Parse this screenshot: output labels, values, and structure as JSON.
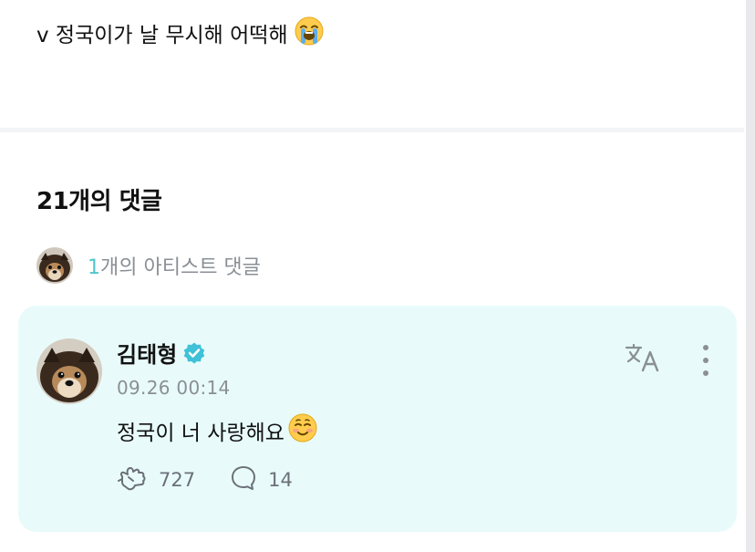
{
  "post": {
    "text": "v 정국이가 날 무시해 어떡해",
    "emoji": "loudly-crying-face"
  },
  "comments_header": {
    "title": "21개의 댓글"
  },
  "artist_comments": {
    "count": "1",
    "label": "개의 아티스트 댓글"
  },
  "comment": {
    "author": "김태형",
    "verified": true,
    "timestamp": "09.26 00:14",
    "text": "정국이 너 사랑해요",
    "emoji": "smiling-face",
    "likes": "727",
    "replies": "14"
  },
  "colors": {
    "accent": "#4fc6cc",
    "card_bg": "#e8fbfa",
    "muted_text": "#8a8f96",
    "verified_badge": "#3fc1d7"
  },
  "icons": {
    "translate": "translate-icon",
    "more": "more-vertical-icon",
    "like": "like-hand-icon",
    "reply": "chat-bubble-icon",
    "verified": "verified-badge-icon"
  }
}
